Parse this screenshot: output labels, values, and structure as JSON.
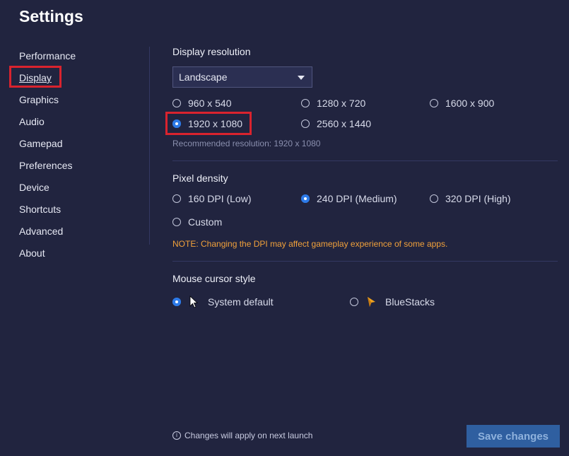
{
  "title": "Settings",
  "nav": {
    "items": [
      {
        "label": "Performance"
      },
      {
        "label": "Display"
      },
      {
        "label": "Graphics"
      },
      {
        "label": "Audio"
      },
      {
        "label": "Gamepad"
      },
      {
        "label": "Preferences"
      },
      {
        "label": "Device"
      },
      {
        "label": "Shortcuts"
      },
      {
        "label": "Advanced"
      },
      {
        "label": "About"
      }
    ],
    "selected": "Display"
  },
  "display_resolution": {
    "title": "Display resolution",
    "orientation": "Landscape",
    "options": [
      "960 x 540",
      "1280 x 720",
      "1600 x 900",
      "1920 x 1080",
      "2560 x 1440"
    ],
    "selected": "1920 x 1080",
    "recommended": "Recommended resolution: 1920 x 1080"
  },
  "pixel_density": {
    "title": "Pixel density",
    "options": [
      "160 DPI (Low)",
      "240 DPI (Medium)",
      "320 DPI (High)",
      "Custom"
    ],
    "selected": "240 DPI (Medium)",
    "note": "NOTE: Changing the DPI may affect gameplay experience of some apps."
  },
  "mouse_cursor": {
    "title": "Mouse cursor style",
    "options": [
      "System default",
      "BlueStacks"
    ],
    "selected": "System default"
  },
  "footer": {
    "note": "Changes will apply on next launch",
    "save_label": "Save changes"
  },
  "colors": {
    "background": "#21243f",
    "accent": "#2d7ae8",
    "highlight": "#d9232e",
    "note": "#f1a13b"
  }
}
